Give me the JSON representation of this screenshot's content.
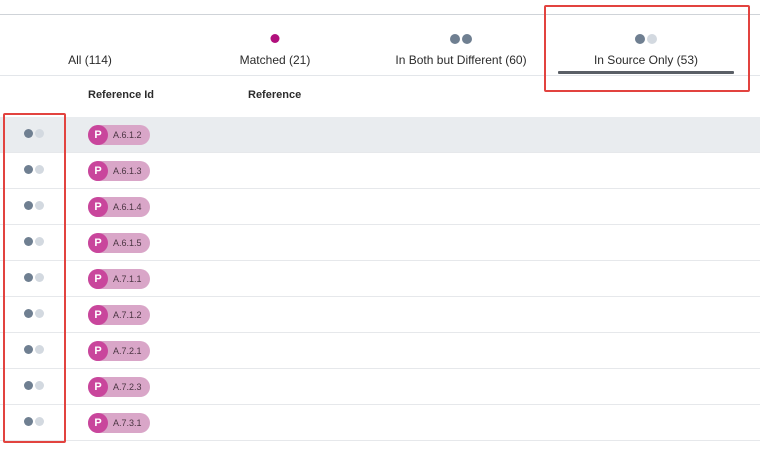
{
  "tabs": [
    {
      "label": "All (114)",
      "indicator": "none"
    },
    {
      "label": "Matched (21)",
      "indicator": "magenta-dot"
    },
    {
      "label": "In Both but Different (60)",
      "indicator": "two-dark-dots"
    },
    {
      "label": "In Source Only (53)",
      "indicator": "dark-light-dots",
      "active": true
    }
  ],
  "columns": {
    "reference_id": "Reference Id",
    "reference": "Reference"
  },
  "chip_badge": "P",
  "rows": [
    {
      "ref_id": "A.6.1.2"
    },
    {
      "ref_id": "A.6.1.3"
    },
    {
      "ref_id": "A.6.1.4"
    },
    {
      "ref_id": "A.6.1.5"
    },
    {
      "ref_id": "A.7.1.1"
    },
    {
      "ref_id": "A.7.1.2"
    },
    {
      "ref_id": "A.7.2.1"
    },
    {
      "ref_id": "A.7.2.3"
    },
    {
      "ref_id": "A.7.3.1"
    }
  ],
  "colors": {
    "accent_magenta": "#b10f7c",
    "chip_bg": "#d9a6c8",
    "chip_badge": "#c9469c",
    "dot_dark": "#6f7f91",
    "dot_light": "#d3d9e0",
    "annotation_red": "#e2433f"
  }
}
